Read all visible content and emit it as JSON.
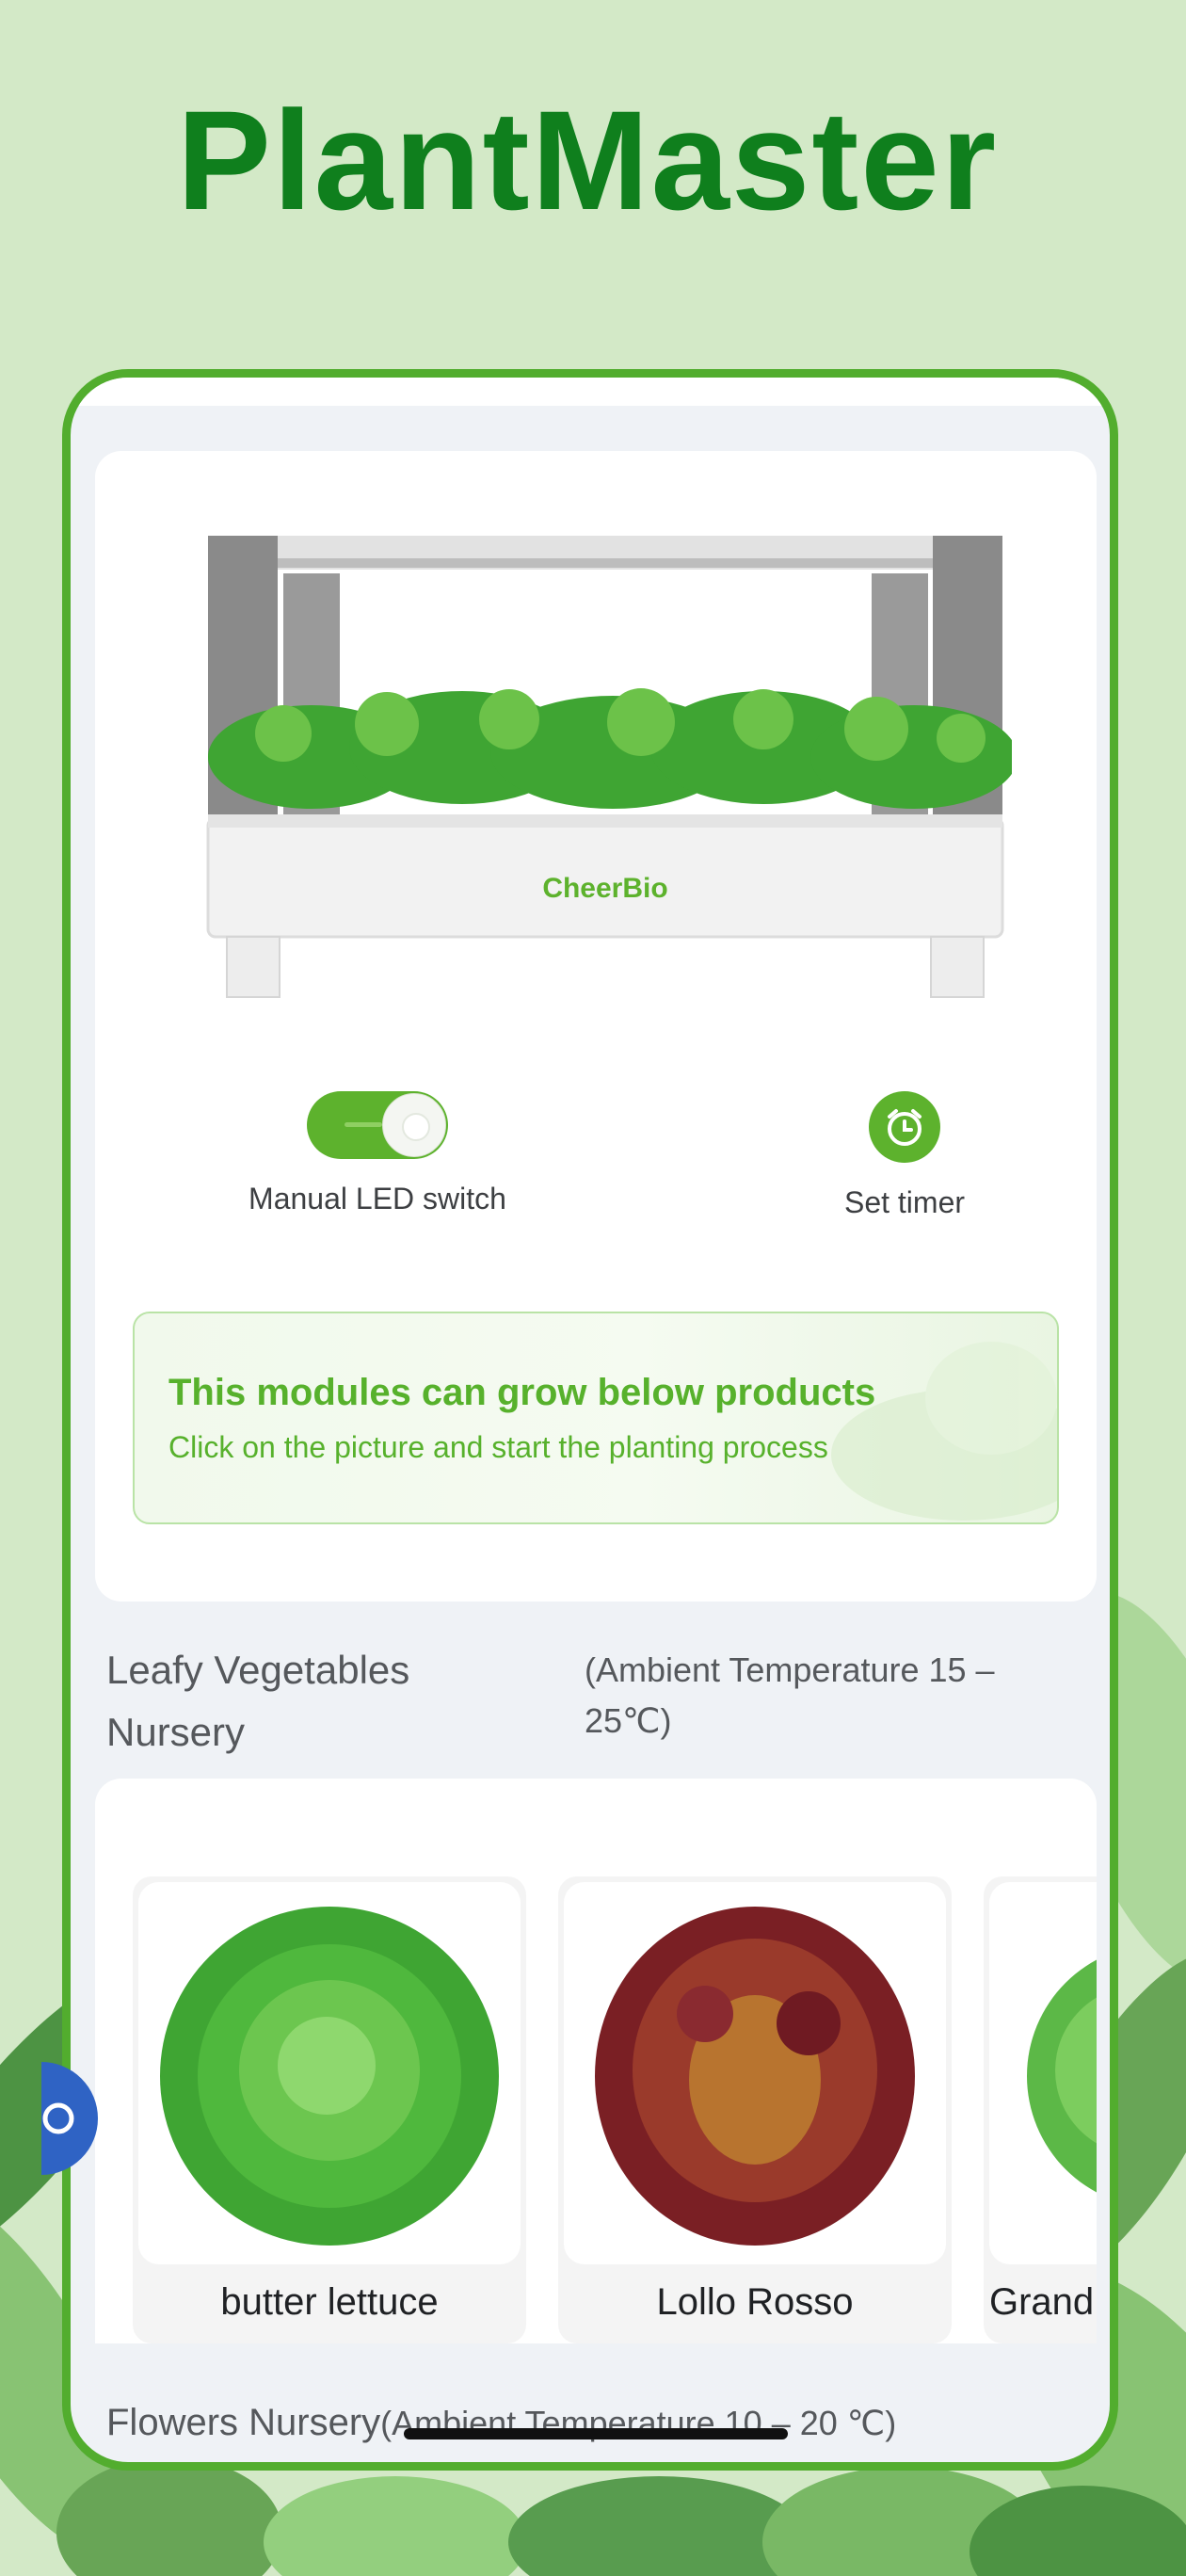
{
  "app": {
    "title": "PlantMaster"
  },
  "device": {
    "brand": "CheerBio",
    "led_switch_label": "Manual LED switch",
    "led_switch_on": true,
    "timer_label": "Set timer"
  },
  "banner": {
    "title": "This modules can grow below products",
    "subtitle": "Click on the picture and start the planting process"
  },
  "leafy_section": {
    "title": "Leafy Vegetables Nursery",
    "note": "(Ambient Temperature 15 – 25℃)",
    "items": [
      {
        "name": "butter lettuce"
      },
      {
        "name": "Lollo Rosso"
      },
      {
        "name": "Grand"
      }
    ]
  },
  "flowers_section": {
    "title": "Flowers Nursery",
    "note": "(Ambient Temperature 10 – 20 ℃)"
  },
  "colors": {
    "brand_green": "#0f7f1d",
    "accent_green": "#5db22d",
    "frame_green": "#52ad2e",
    "background": "#d3e9c7"
  },
  "icons": [
    "toggle-switch-icon",
    "alarm-clock-icon"
  ]
}
